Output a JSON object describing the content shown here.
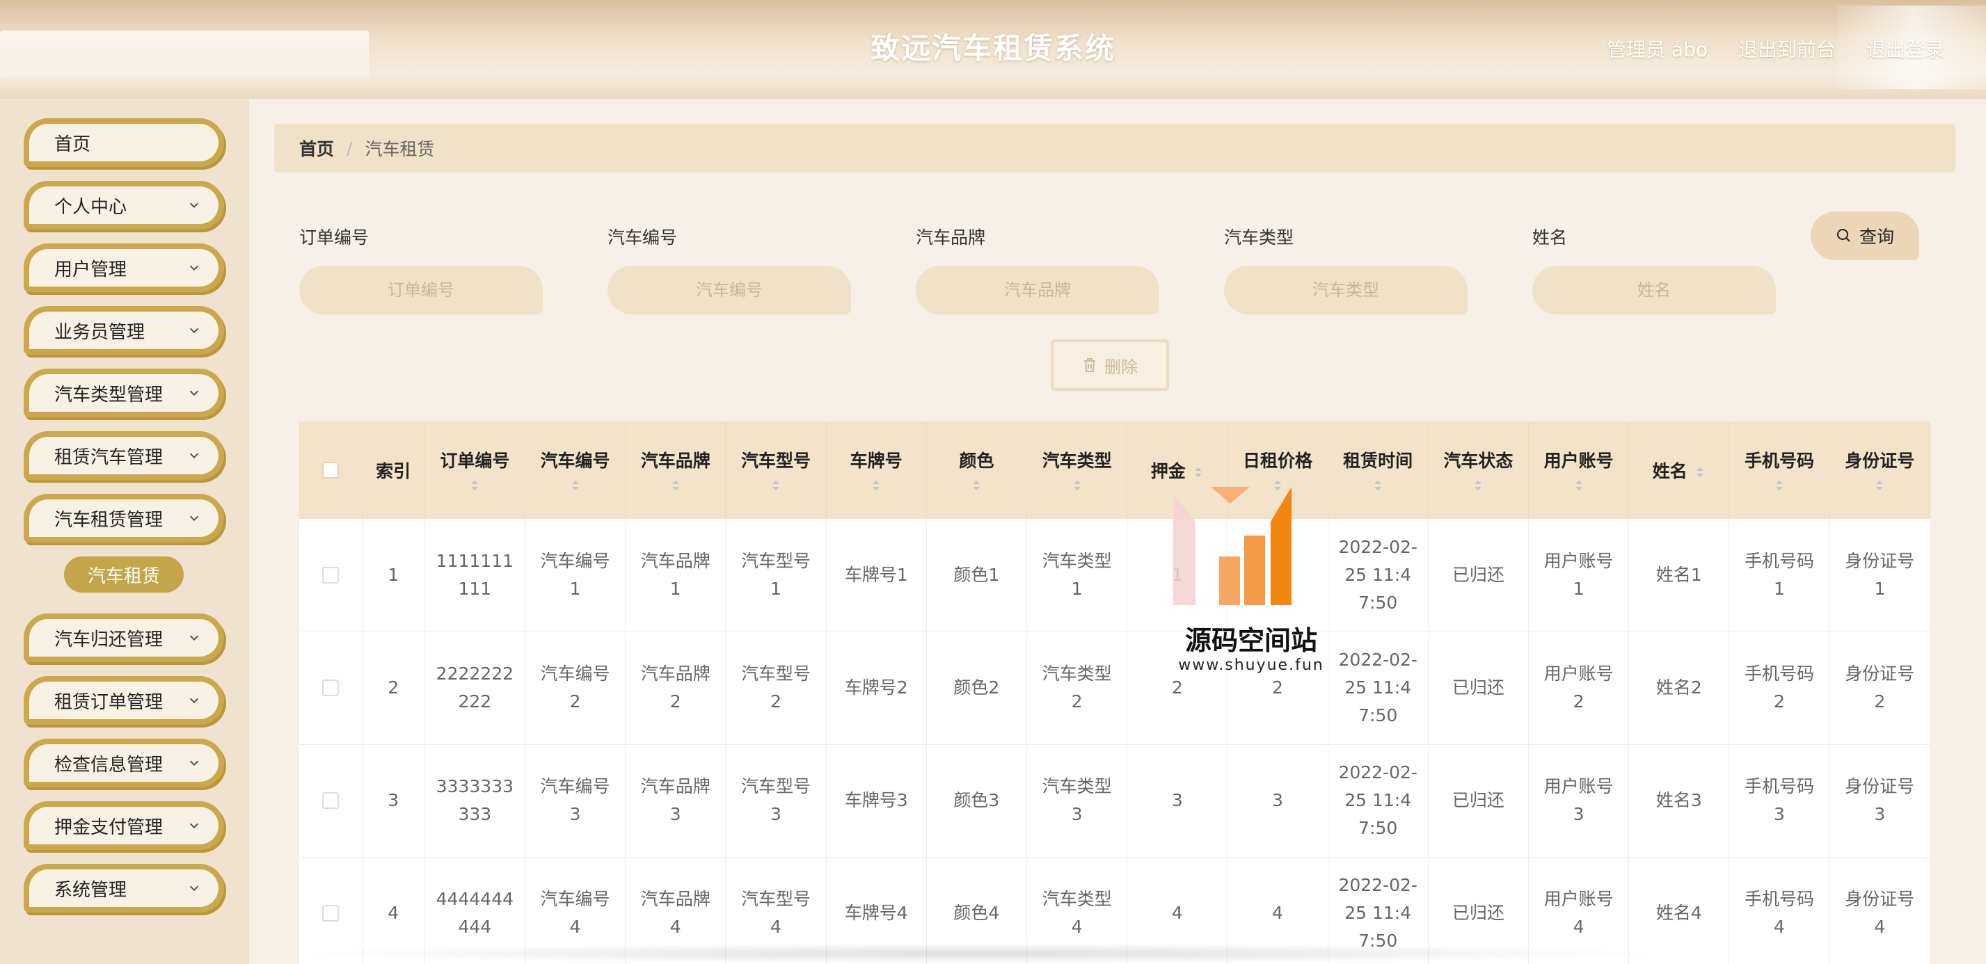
{
  "header": {
    "title": "致远汽车租赁系统",
    "user": "管理员 abo",
    "front": "退出到前台",
    "logout": "退出登录"
  },
  "sidebar": {
    "items": [
      {
        "label": "首页",
        "has_arrow": false
      },
      {
        "label": "个人中心",
        "has_arrow": true
      },
      {
        "label": "用户管理",
        "has_arrow": true
      },
      {
        "label": "业务员管理",
        "has_arrow": true
      },
      {
        "label": "汽车类型管理",
        "has_arrow": true
      },
      {
        "label": "租赁汽车管理",
        "has_arrow": true
      },
      {
        "label": "汽车租赁管理",
        "has_arrow": true
      },
      {
        "label": "汽车归还管理",
        "has_arrow": true
      },
      {
        "label": "租赁订单管理",
        "has_arrow": true
      },
      {
        "label": "检查信息管理",
        "has_arrow": true
      },
      {
        "label": "押金支付管理",
        "has_arrow": true
      },
      {
        "label": "系统管理",
        "has_arrow": true
      }
    ],
    "active_sub": "汽车租赁"
  },
  "breadcrumb": {
    "home": "首页",
    "sep": "/",
    "current": "汽车租赁"
  },
  "search": {
    "fields": [
      {
        "label": "订单编号",
        "placeholder": "订单编号"
      },
      {
        "label": "汽车编号",
        "placeholder": "汽车编号"
      },
      {
        "label": "汽车品牌",
        "placeholder": "汽车品牌"
      },
      {
        "label": "汽车类型",
        "placeholder": "汽车类型"
      },
      {
        "label": "姓名",
        "placeholder": "姓名"
      }
    ],
    "button": "查询"
  },
  "actions": {
    "delete": "删除"
  },
  "table": {
    "headers": [
      "索引",
      "订单编号",
      "汽车编号",
      "汽车品牌",
      "汽车型号",
      "车牌号",
      "颜色",
      "汽车类型",
      "押金",
      "日租价格",
      "租赁时间",
      "汽车状态",
      "用户账号",
      "姓名",
      "手机号码",
      "身份证号"
    ],
    "rows": [
      [
        "1",
        "1111111111",
        "汽车编号1",
        "汽车品牌1",
        "汽车型号1",
        "车牌号1",
        "颜色1",
        "汽车类型1",
        "1",
        "1",
        "2022-02-25 11:47:50",
        "已归还",
        "用户账号1",
        "姓名1",
        "手机号码1",
        "身份证号1"
      ],
      [
        "2",
        "2222222222",
        "汽车编号2",
        "汽车品牌2",
        "汽车型号2",
        "车牌号2",
        "颜色2",
        "汽车类型2",
        "2",
        "2",
        "2022-02-25 11:47:50",
        "已归还",
        "用户账号2",
        "姓名2",
        "手机号码2",
        "身份证号2"
      ],
      [
        "3",
        "3333333333",
        "汽车编号3",
        "汽车品牌3",
        "汽车型号3",
        "车牌号3",
        "颜色3",
        "汽车类型3",
        "3",
        "3",
        "2022-02-25 11:47:50",
        "已归还",
        "用户账号3",
        "姓名3",
        "手机号码3",
        "身份证号3"
      ],
      [
        "4",
        "4444444444",
        "汽车编号4",
        "汽车品牌4",
        "汽车型号4",
        "车牌号4",
        "颜色4",
        "汽车类型4",
        "4",
        "4",
        "2022-02-25 11:47:50",
        "已归还",
        "用户账号4",
        "姓名4",
        "手机号码4",
        "身份证号4"
      ]
    ]
  },
  "watermark": {
    "title": "源码空间站",
    "url": "www.shuyue.fun"
  },
  "colors": {
    "accent": "#c9a94b",
    "header_bg": "#efe0cb",
    "table_head": "#f3e3cb"
  }
}
